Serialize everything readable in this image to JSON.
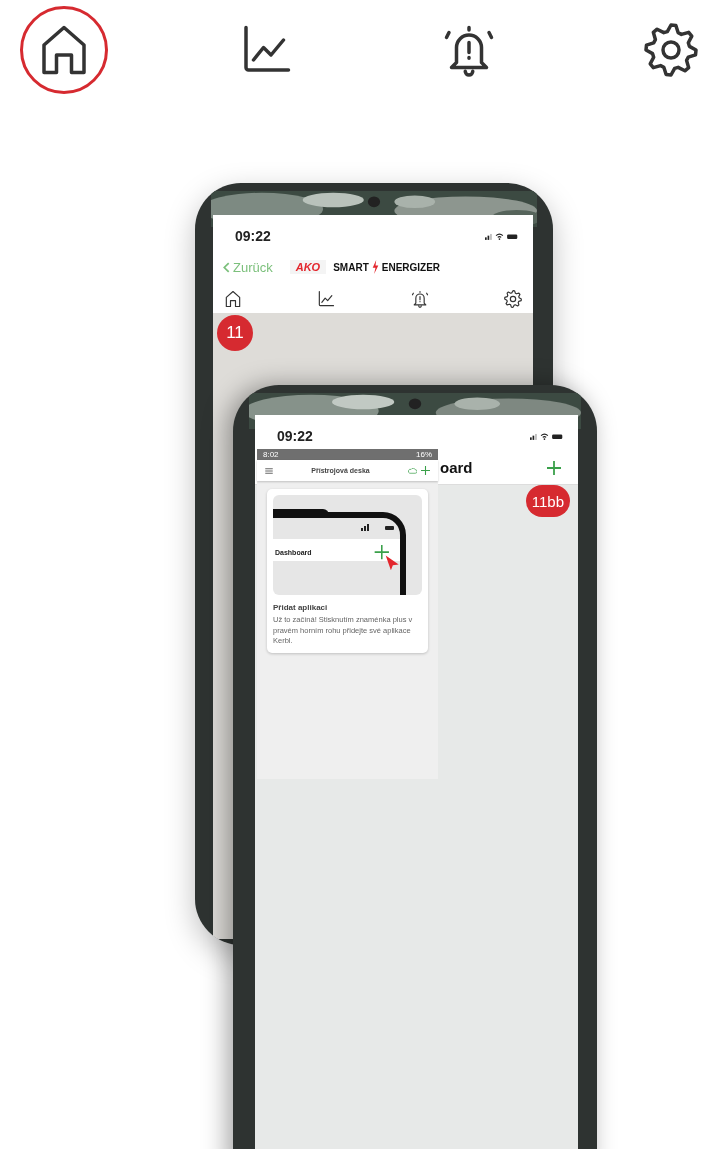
{
  "nav": [
    {
      "kind": "home",
      "selected": true
    },
    {
      "kind": "chart",
      "selected": false
    },
    {
      "kind": "bell",
      "selected": false
    },
    {
      "kind": "gear",
      "selected": false
    }
  ],
  "back_phone": {
    "time": "09:22",
    "back_link": "Zurück",
    "brand": {
      "mark": "AKO",
      "word_1": "SMART",
      "word_2": "ENERGIZER"
    },
    "tabs": [
      {
        "kind": "home"
      },
      {
        "kind": "chart"
      },
      {
        "kind": "bell"
      },
      {
        "kind": "gear"
      }
    ],
    "badge": "11"
  },
  "front_phone": {
    "time": "09:22",
    "title": "oard",
    "badge": "11bb",
    "inset": {
      "time": "8:02",
      "battery": "16%",
      "title": "Přístrojová deska",
      "card": {
        "preview_title": "Dashboard",
        "heading": "Přidat aplikaci",
        "text": "Už to začíná! Stisknutím znaménka plus v pravém horním rohu přidejte své aplikace Kerbl."
      }
    }
  }
}
